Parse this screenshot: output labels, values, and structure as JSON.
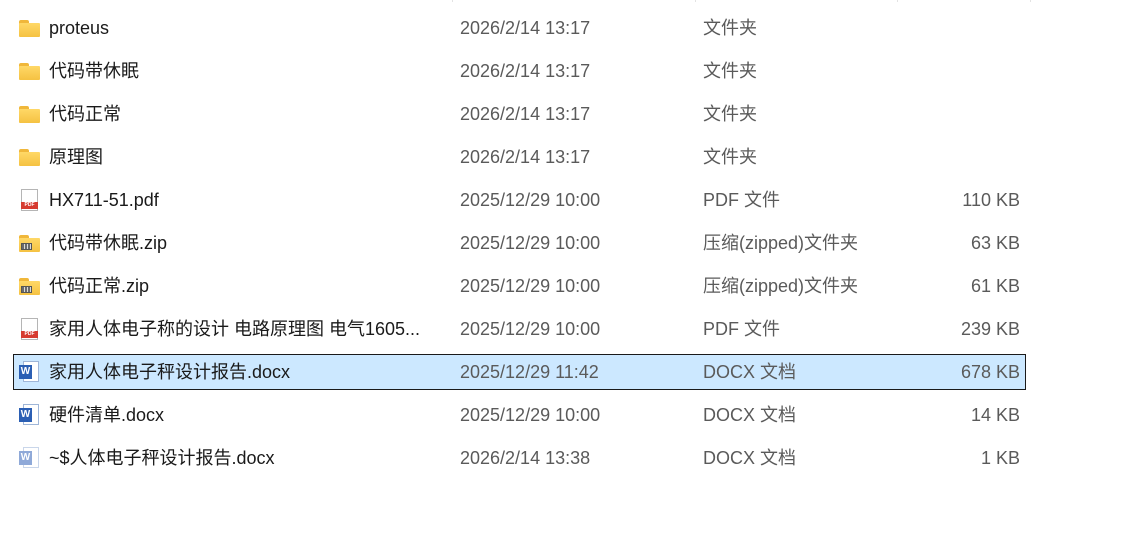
{
  "files": [
    {
      "name": "proteus",
      "date": "2026/2/14 13:17",
      "type": "文件夹",
      "size": "",
      "icon": "folder-icon",
      "selected": false
    },
    {
      "name": "代码带休眠",
      "date": "2026/2/14 13:17",
      "type": "文件夹",
      "size": "",
      "icon": "folder-icon",
      "selected": false
    },
    {
      "name": "代码正常",
      "date": "2026/2/14 13:17",
      "type": "文件夹",
      "size": "",
      "icon": "folder-icon",
      "selected": false
    },
    {
      "name": "原理图",
      "date": "2026/2/14 13:17",
      "type": "文件夹",
      "size": "",
      "icon": "folder-icon",
      "selected": false
    },
    {
      "name": "HX711-51.pdf",
      "date": "2025/12/29 10:00",
      "type": "PDF 文件",
      "size": "110 KB",
      "icon": "pdf-icon",
      "selected": false
    },
    {
      "name": "代码带休眠.zip",
      "date": "2025/12/29 10:00",
      "type": "压缩(zipped)文件夹",
      "size": "63 KB",
      "icon": "zip-icon",
      "selected": false
    },
    {
      "name": "代码正常.zip",
      "date": "2025/12/29 10:00",
      "type": "压缩(zipped)文件夹",
      "size": "61 KB",
      "icon": "zip-icon",
      "selected": false
    },
    {
      "name": "家用人体电子称的设计  电路原理图 电气1605...",
      "date": "2025/12/29 10:00",
      "type": "PDF 文件",
      "size": "239 KB",
      "icon": "pdf-icon",
      "selected": false
    },
    {
      "name": "家用人体电子秤设计报告.docx",
      "date": "2025/12/29 11:42",
      "type": "DOCX 文档",
      "size": "678 KB",
      "icon": "word-icon",
      "selected": true
    },
    {
      "name": "硬件清单.docx",
      "date": "2025/12/29 10:00",
      "type": "DOCX 文档",
      "size": "14 KB",
      "icon": "word-icon",
      "selected": false
    },
    {
      "name": "~$人体电子秤设计报告.docx",
      "date": "2026/2/14 13:38",
      "type": "DOCX 文档",
      "size": "1 KB",
      "icon": "word-temp-icon",
      "selected": false
    }
  ],
  "icon_labels": {
    "pdf": "PDF",
    "word": "W"
  },
  "colors": {
    "selection_bg": "#cce8ff",
    "selection_border": "#1a1a1a",
    "secondary_text": "#5a5a5a"
  }
}
